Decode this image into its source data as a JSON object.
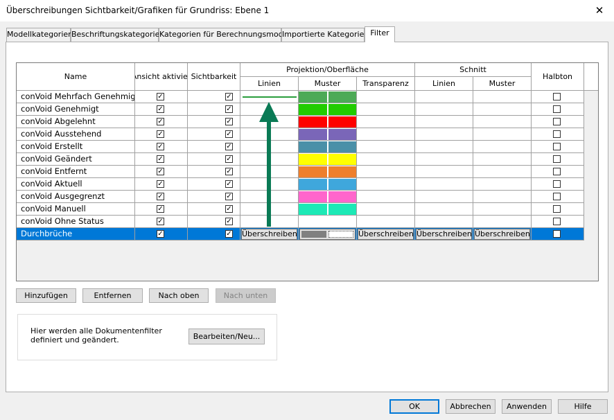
{
  "window": {
    "title": "Überschreibungen Sichtbarkeit/Grafiken für Grundriss: Ebene 1",
    "close_glyph": "✕"
  },
  "tabs": [
    {
      "label": "Modellkategorien",
      "active": false
    },
    {
      "label": "Beschriftungskategorien",
      "active": false
    },
    {
      "label": "Kategorien für Berechnungsmodell",
      "active": false
    },
    {
      "label": "Importierte Kategorien",
      "active": false
    },
    {
      "label": "Filter",
      "active": true
    }
  ],
  "table": {
    "headers": {
      "name": "Name",
      "in_view": "In Ansicht aktivieren",
      "visibility": "Sichtbarkeit",
      "projection_group": "Projektion/Oberfläche",
      "proj_lines": "Linien",
      "proj_pattern": "Muster",
      "proj_transparency": "Transparenz",
      "cut_group": "Schnitt",
      "cut_lines": "Linien",
      "cut_pattern": "Muster",
      "halftone": "Halbton"
    },
    "rows": [
      {
        "name": "conVoid Mehrfach Genehmigt",
        "in_view": true,
        "visible": true,
        "halftone": false,
        "pattern_color": "#4daa57",
        "line_color": "#2a9d3c"
      },
      {
        "name": "conVoid Genehmigt",
        "in_view": true,
        "visible": true,
        "halftone": false,
        "pattern_color": "#22cc00",
        "line_color": ""
      },
      {
        "name": "conVoid Abgelehnt",
        "in_view": true,
        "visible": true,
        "halftone": false,
        "pattern_color": "#ff0000",
        "line_color": ""
      },
      {
        "name": "conVoid Ausstehend",
        "in_view": true,
        "visible": true,
        "halftone": false,
        "pattern_color": "#7a66b8",
        "line_color": ""
      },
      {
        "name": "conVoid Erstellt",
        "in_view": true,
        "visible": true,
        "halftone": false,
        "pattern_color": "#4a90a8",
        "line_color": ""
      },
      {
        "name": "conVoid Geändert",
        "in_view": true,
        "visible": true,
        "halftone": false,
        "pattern_color": "#ffff00",
        "line_color": ""
      },
      {
        "name": "conVoid Entfernt",
        "in_view": true,
        "visible": true,
        "halftone": false,
        "pattern_color": "#ee7f2d",
        "line_color": ""
      },
      {
        "name": "conVoid Aktuell",
        "in_view": true,
        "visible": true,
        "halftone": false,
        "pattern_color": "#3fa7dc",
        "line_color": ""
      },
      {
        "name": "conVoid Ausgegrenzt",
        "in_view": true,
        "visible": true,
        "halftone": false,
        "pattern_color": "#ff66cc",
        "line_color": ""
      },
      {
        "name": "conVoid Manuell",
        "in_view": true,
        "visible": true,
        "halftone": false,
        "pattern_color": "#1de9b6",
        "line_color": ""
      },
      {
        "name": "conVoid Ohne Status",
        "in_view": true,
        "visible": true,
        "halftone": false,
        "pattern_color": "",
        "line_color": ""
      }
    ],
    "selected_row": {
      "name": "Durchbrüche",
      "in_view": true,
      "visible": true,
      "halftone": false,
      "proj_lines_button": "Überschreiben...",
      "transparency_button": "Überschreiben...",
      "cut_lines_button": "Überschreiben...",
      "cut_pattern_button": "Überschreiben..."
    }
  },
  "annotation": {
    "arrow_color": "#0a7a55",
    "icon": "up-arrow-icon"
  },
  "buttons": {
    "add": "Hinzufügen",
    "remove": "Entfernen",
    "move_up": "Nach oben",
    "move_down": "Nach unten",
    "edit_new": "Bearbeiten/Neu...",
    "ok": "OK",
    "cancel": "Abbrechen",
    "apply": "Anwenden",
    "help": "Hilfe"
  },
  "info": {
    "text": "Hier werden alle Dokumentenfilter definiert und geändert."
  },
  "colors": {
    "selection": "#0078d7",
    "default_button_border": "#0078d7"
  }
}
